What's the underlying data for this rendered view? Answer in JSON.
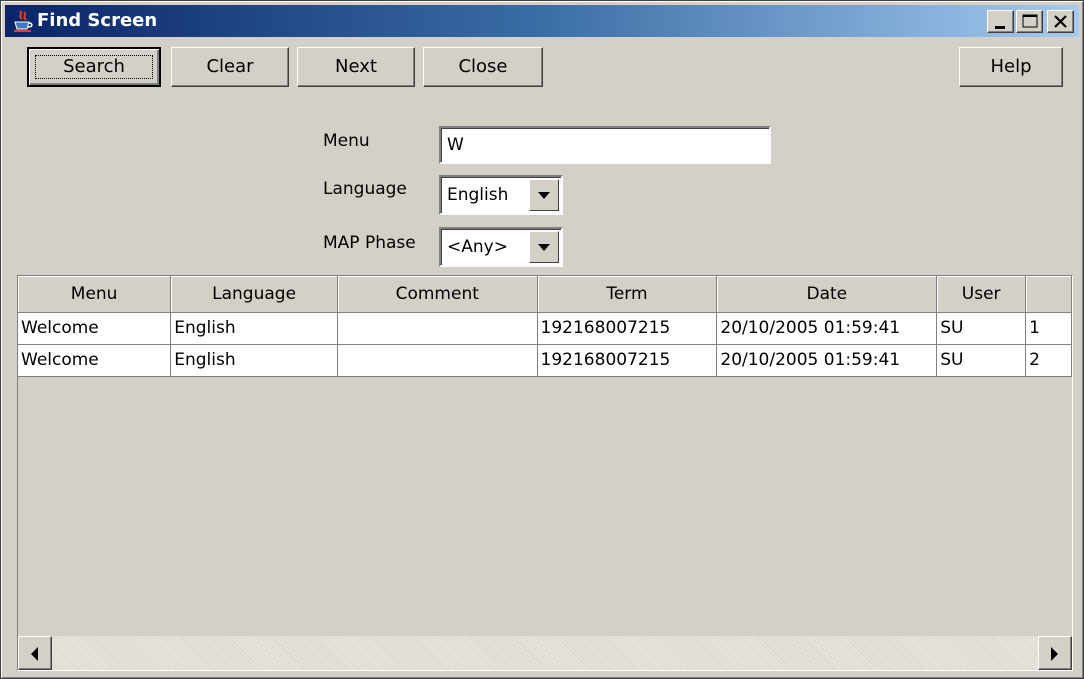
{
  "window": {
    "title": "Find Screen",
    "title_icon": "java-cup-icon",
    "controls": [
      "minimize-icon",
      "maximize-icon",
      "close-icon"
    ]
  },
  "toolbar": {
    "search_label": "Search",
    "clear_label": "Clear",
    "next_label": "Next",
    "close_label": "Close",
    "help_label": "Help"
  },
  "form": {
    "menu_label": "Menu",
    "menu_value": "W",
    "language_label": "Language",
    "language_value": "English",
    "phase_label": "MAP Phase",
    "phase_value": "<Any>"
  },
  "table": {
    "columns": [
      "Menu",
      "Language",
      "Comment",
      "Term",
      "Date",
      "User",
      ""
    ],
    "rows": [
      [
        "Welcome",
        "English",
        "",
        "192168007215",
        "20/10/2005 01:59:41",
        "SU",
        "1"
      ],
      [
        "Welcome",
        "English",
        "",
        "192168007215",
        "20/10/2005 01:59:41",
        "SU",
        "2"
      ]
    ]
  },
  "colors": {
    "title_gradient_start": "#0a246a",
    "title_gradient_end": "#a6caf0",
    "face": "#d4d0c8"
  }
}
